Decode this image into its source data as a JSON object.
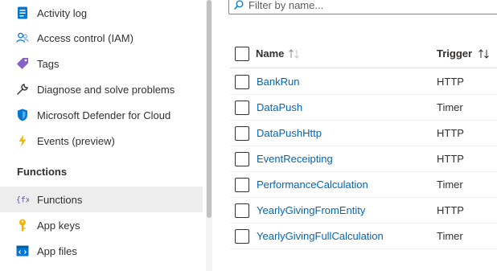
{
  "sidebar": {
    "items": [
      {
        "label": "Activity log",
        "icon": "activity-log-icon"
      },
      {
        "label": "Access control (IAM)",
        "icon": "people-icon"
      },
      {
        "label": "Tags",
        "icon": "tag-icon"
      },
      {
        "label": "Diagnose and solve problems",
        "icon": "wrench-icon"
      },
      {
        "label": "Microsoft Defender for Cloud",
        "icon": "shield-icon"
      },
      {
        "label": "Events (preview)",
        "icon": "lightning-icon"
      }
    ],
    "section_header": "Functions",
    "section_items": [
      {
        "label": "Functions",
        "icon": "function-icon",
        "selected": true
      },
      {
        "label": "App keys",
        "icon": "key-icon"
      },
      {
        "label": "App files",
        "icon": "code-file-icon"
      }
    ]
  },
  "filter": {
    "placeholder": "Filter by name..."
  },
  "table": {
    "columns": {
      "name": "Name",
      "trigger": "Trigger"
    },
    "rows": [
      {
        "name": "BankRun",
        "trigger": "HTTP"
      },
      {
        "name": "DataPush",
        "trigger": "Timer"
      },
      {
        "name": "DataPushHttp",
        "trigger": "HTTP"
      },
      {
        "name": "EventReceipting",
        "trigger": "HTTP"
      },
      {
        "name": "PerformanceCalculation",
        "trigger": "Timer"
      },
      {
        "name": "YearlyGivingFromEntity",
        "trigger": "HTTP"
      },
      {
        "name": "YearlyGivingFullCalculation",
        "trigger": "Timer"
      }
    ]
  },
  "colors": {
    "link": "#0067b8",
    "selected_bg": "#ededed",
    "accent": "#0078d4"
  }
}
